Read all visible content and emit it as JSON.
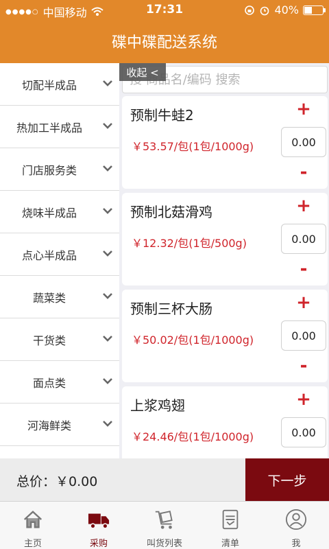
{
  "status_bar": {
    "signal": "●●●●○",
    "carrier": "中国移动",
    "time": "17:31",
    "battery": "40%",
    "battery_level": 0.4
  },
  "header": {
    "title": "碟中碟配送系统"
  },
  "sidebar": {
    "collapse_label": "收起 <",
    "items": [
      {
        "label": "切配半成品"
      },
      {
        "label": "热加工半成品"
      },
      {
        "label": "门店服务类"
      },
      {
        "label": "烧味半成品"
      },
      {
        "label": "点心半成品"
      },
      {
        "label": "蔬菜类"
      },
      {
        "label": "干货类"
      },
      {
        "label": "面点类"
      },
      {
        "label": "河海鲜类"
      }
    ]
  },
  "search": {
    "placeholder": "搜 商品名/编码 搜索"
  },
  "products": [
    {
      "name": "预制牛蛙2",
      "price": "￥53.57/包(1包/1000g)",
      "qty": "0.00",
      "plus": "+",
      "minus": "-"
    },
    {
      "name": "预制北菇滑鸡",
      "price": "￥12.32/包(1包/500g)",
      "qty": "0.00",
      "plus": "+",
      "minus": "-"
    },
    {
      "name": "预制三杯大肠",
      "price": "￥50.02/包(1包/1000g)",
      "qty": "0.00",
      "plus": "+",
      "minus": "-"
    },
    {
      "name": "上浆鸡翅",
      "price": "￥24.46/包(1包/1000g)",
      "qty": "0.00",
      "plus": "+",
      "minus": "-"
    }
  ],
  "total": {
    "text": "总价：￥0.00",
    "next_label": "下一步"
  },
  "tabs": [
    {
      "label": "主页",
      "icon": "home-icon"
    },
    {
      "label": "采购",
      "icon": "truck-icon"
    },
    {
      "label": "叫货列表",
      "icon": "cart-list-icon"
    },
    {
      "label": "清单",
      "icon": "checklist-icon"
    },
    {
      "label": "我",
      "icon": "user-icon"
    }
  ],
  "colors": {
    "brand_orange": "#e2882a",
    "accent_red": "#d0242b",
    "dark_red": "#7b0a10"
  }
}
